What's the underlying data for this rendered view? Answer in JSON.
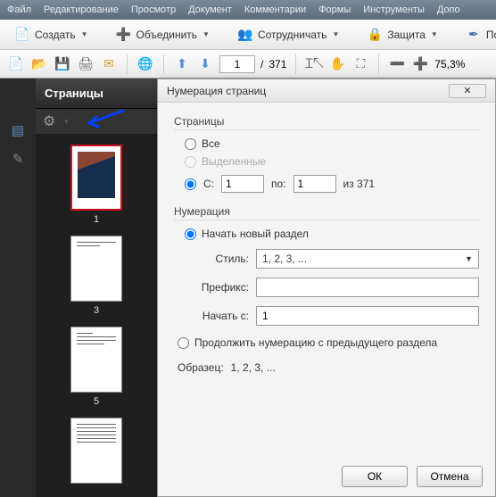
{
  "menubar": [
    "Файл",
    "Редактирование",
    "Просмотр",
    "Документ",
    "Комментарии",
    "Формы",
    "Инструменты",
    "Допо"
  ],
  "toolbar1": {
    "create": "Создать",
    "merge": "Объединить",
    "collab": "Сотрудничать",
    "protect": "Защита",
    "sign": "Подпись"
  },
  "toolbar2": {
    "page_current": "1",
    "page_sep": "/",
    "page_total": "371",
    "zoom": "75,3%"
  },
  "pages_panel": {
    "title": "Страницы",
    "thumbs": [
      "1",
      "3",
      "5"
    ]
  },
  "dialog": {
    "title": "Нумерация страниц",
    "close": "✕",
    "group_pages": "Страницы",
    "opt_all": "Все",
    "opt_selected": "Выделенные",
    "opt_from": "С:",
    "from_val": "1",
    "to_label": "по:",
    "to_val": "1",
    "of_total": "из 371",
    "group_num": "Нумерация",
    "opt_new_section": "Начать новый раздел",
    "style_label": "Стиль:",
    "style_value": "1, 2, 3, ...",
    "prefix_label": "Префикс:",
    "prefix_value": "",
    "start_label": "Начать с:",
    "start_value": "1",
    "opt_continue": "Продолжить нумерацию с предыдущего раздела",
    "sample_label": "Образец:",
    "sample_value": "1, 2, 3, ...",
    "ok": "ОК",
    "cancel": "Отмена"
  }
}
